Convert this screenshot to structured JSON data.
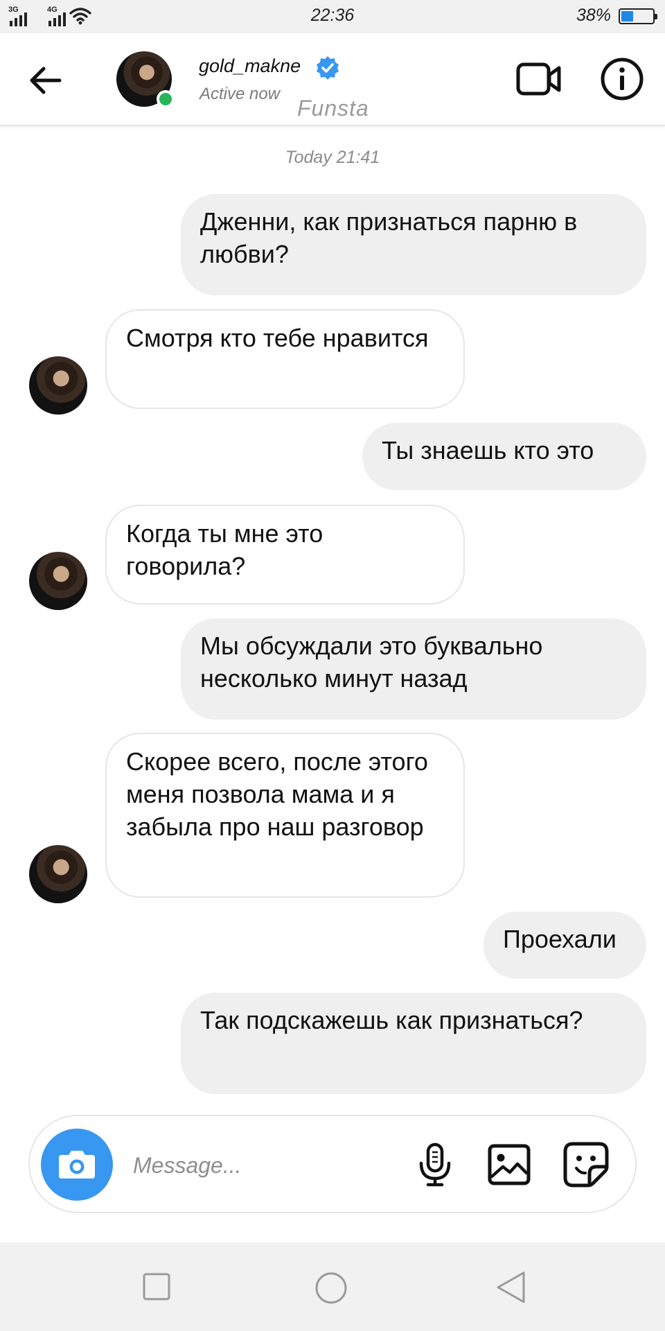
{
  "status_bar": {
    "network_1": "3G",
    "network_2": "4G",
    "time": "22:36",
    "battery_percent": "38%",
    "battery_level": 0.38
  },
  "header": {
    "username": "gold_makne",
    "status": "Active now",
    "watermark": "Funsta"
  },
  "chat": {
    "timestamp": "Today 21:41",
    "messages": [
      {
        "direction": "outgoing",
        "text": "Дженни, как признаться парню в любви?"
      },
      {
        "direction": "incoming",
        "text": "Смотря кто тебе нравится"
      },
      {
        "direction": "outgoing",
        "text": "Ты знаешь кто это"
      },
      {
        "direction": "incoming",
        "text": "Когда ты мне это говорила?"
      },
      {
        "direction": "outgoing",
        "text": "Мы обсуждали это буквально несколько минут назад"
      },
      {
        "direction": "incoming",
        "text": "Скорее всего, после этого меня позвола мама и я забыла про наш разговор"
      },
      {
        "direction": "outgoing",
        "text": "Проехали"
      },
      {
        "direction": "outgoing",
        "text": "Так подскажешь как признаться?"
      }
    ]
  },
  "composer": {
    "placeholder": "Message...",
    "value": ""
  },
  "colors": {
    "accent_blue": "#3897f0",
    "online_green": "#29b35a",
    "outgoing_bubble": "#efefef",
    "battery_fill": "#1e88e5"
  },
  "icons": {
    "back": "arrow-left-icon",
    "verified": "verified-badge-icon",
    "video": "video-camera-icon",
    "info": "info-icon",
    "camera": "camera-icon",
    "mic": "microphone-icon",
    "gallery": "image-icon",
    "sticker": "sticker-icon"
  }
}
